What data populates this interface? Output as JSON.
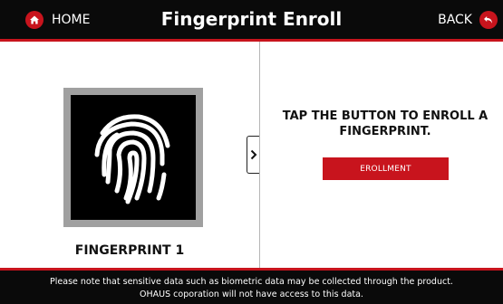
{
  "header": {
    "home_label": "HOME",
    "title": "Fingerprint Enroll",
    "back_label": "BACK"
  },
  "left_panel": {
    "fingerprint_label": "FINGERPRINT 1"
  },
  "right_panel": {
    "instruction": "TAP THE BUTTON TO ENROLL A FINGERPRINT.",
    "enroll_button_label": "EROLLMENT"
  },
  "footer": {
    "notice_line1": "Please note that sensitive data such as biometric data may be collected through the product.",
    "notice_line2": "OHAUS coporation will not have access to this data."
  },
  "icons": {
    "home": "home-icon",
    "back": "back-arrow-icon",
    "fingerprint": "fingerprint-icon",
    "collapse": "chevron-right-icon"
  },
  "colors": {
    "accent_red": "#c8141d",
    "bar_black": "#0a0a0a",
    "frame_gray": "#a0a0a0"
  }
}
